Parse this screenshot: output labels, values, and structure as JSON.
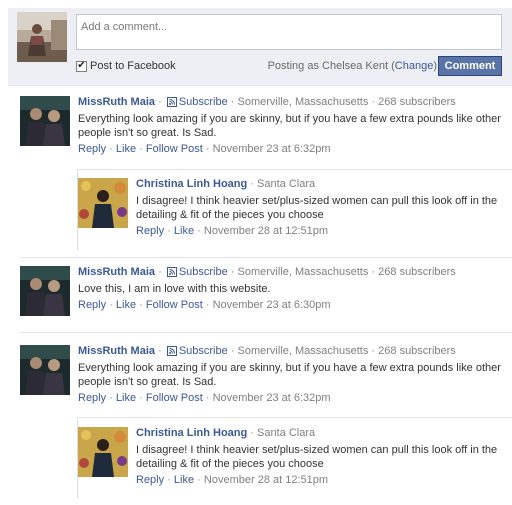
{
  "composer": {
    "placeholder": "Add a comment...",
    "post_to_facebook_label": "Post to Facebook",
    "post_to_facebook_checked": true,
    "posting_as_prefix": "Posting as Chelsea Kent (",
    "change_label": "Change",
    "posting_as_suffix": ")",
    "comment_button": "Comment"
  },
  "comments": [
    {
      "author": "MissRuth Maia",
      "subscribe_label": "Subscribe",
      "location": "Somerville, Massachusetts",
      "subscribers": "268 subscribers",
      "text": "Everything look amazing if you are skinny, but if you have a few extra pounds like other people isn't so great. Is Sad.",
      "reply": "Reply",
      "like": "Like",
      "follow": "Follow Post",
      "time": "November 23 at 6:32pm",
      "replies": [
        {
          "author": "Christina Linh Hoang",
          "location": "Santa Clara",
          "text": "I disagree! I think heavier set/plus-sized women can pull this look off in the detailing & fit of the pieces you choose",
          "reply": "Reply",
          "like": "Like",
          "time": "November 28 at 12:51pm"
        }
      ]
    },
    {
      "author": "MissRuth Maia",
      "subscribe_label": "Subscribe",
      "location": "Somerville, Massachusetts",
      "subscribers": "268 subscribers",
      "text": "Love this, I am in love with this website.",
      "reply": "Reply",
      "like": "Like",
      "follow": "Follow Post",
      "time": "November 23 at 6:30pm"
    },
    {
      "author": "MissRuth Maia",
      "subscribe_label": "Subscribe",
      "location": "Somerville, Massachusetts",
      "subscribers": "268 subscribers",
      "text": "Everything look amazing if you are skinny, but if you have a few extra pounds like other people isn't so great. Is Sad.",
      "reply": "Reply",
      "like": "Like",
      "follow": "Follow Post",
      "time": "November 23 at 6:32pm",
      "replies": [
        {
          "author": "Christina Linh Hoang",
          "location": "Santa Clara",
          "text": "I disagree! I think heavier set/plus-sized women can pull this look off in the detailing & fit of the pieces you choose",
          "reply": "Reply",
          "like": "Like",
          "time": "November 28 at 12:51pm"
        }
      ]
    }
  ],
  "colors": {
    "link": "#3b5998",
    "button": "#5b74a8",
    "composer_bg": "#edeff4"
  }
}
